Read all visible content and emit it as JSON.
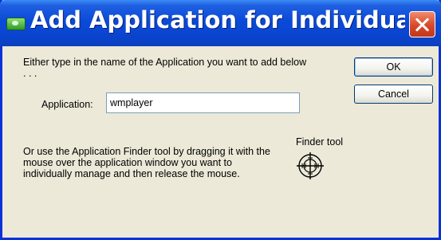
{
  "window": {
    "title": "Add Application for Individual...",
    "close_symbol": "✕"
  },
  "content": {
    "instruction_top": "Either type in the name of the Application you want to add below . . .",
    "application_label": "Application:",
    "application_value": "wmplayer",
    "instruction_finder": "Or use the Application Finder tool by dragging it with the mouse over the application window you want to individually manage and then release the mouse.",
    "finder_label": "Finder tool"
  },
  "buttons": {
    "ok": "OK",
    "cancel": "Cancel"
  },
  "icons": {
    "app": "nvidia-app-icon",
    "close": "close-icon",
    "finder": "crosshair-finder-icon"
  },
  "colors": {
    "titlebar": "#0a46d2",
    "close_button": "#d8482a",
    "window_bg": "#ece9d8"
  }
}
